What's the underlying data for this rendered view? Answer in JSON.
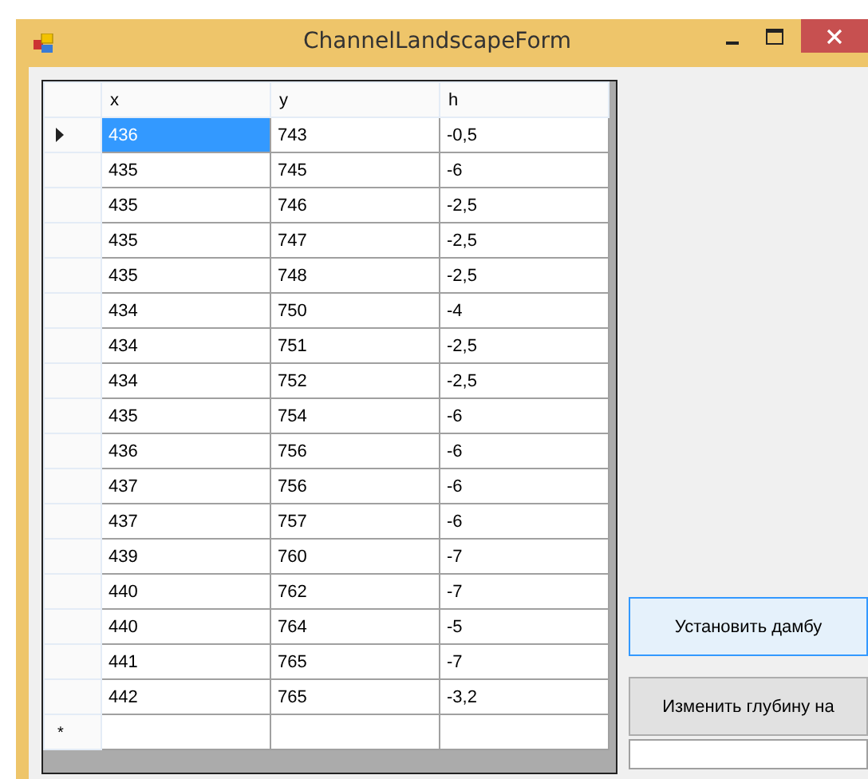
{
  "window": {
    "title": "ChannelLandscapeForm"
  },
  "grid": {
    "columns": [
      "x",
      "y",
      "h"
    ],
    "new_row_marker": "*",
    "rows": [
      {
        "current": true,
        "cells": [
          {
            "text": "436",
            "selected": true
          },
          {
            "text": "743",
            "selected": false
          },
          {
            "text": "-0,5",
            "selected": false
          }
        ]
      },
      {
        "current": false,
        "cells": [
          {
            "text": "435",
            "selected": false
          },
          {
            "text": "745",
            "selected": false
          },
          {
            "text": "-6",
            "selected": false
          }
        ]
      },
      {
        "current": false,
        "cells": [
          {
            "text": "435",
            "selected": false
          },
          {
            "text": "746",
            "selected": false
          },
          {
            "text": "-2,5",
            "selected": false
          }
        ]
      },
      {
        "current": false,
        "cells": [
          {
            "text": "435",
            "selected": false
          },
          {
            "text": "747",
            "selected": false
          },
          {
            "text": "-2,5",
            "selected": false
          }
        ]
      },
      {
        "current": false,
        "cells": [
          {
            "text": "435",
            "selected": false
          },
          {
            "text": "748",
            "selected": false
          },
          {
            "text": "-2,5",
            "selected": false
          }
        ]
      },
      {
        "current": false,
        "cells": [
          {
            "text": "434",
            "selected": false
          },
          {
            "text": "750",
            "selected": false
          },
          {
            "text": "-4",
            "selected": false
          }
        ]
      },
      {
        "current": false,
        "cells": [
          {
            "text": "434",
            "selected": false
          },
          {
            "text": "751",
            "selected": false
          },
          {
            "text": "-2,5",
            "selected": false
          }
        ]
      },
      {
        "current": false,
        "cells": [
          {
            "text": "434",
            "selected": false
          },
          {
            "text": "752",
            "selected": false
          },
          {
            "text": "-2,5",
            "selected": false
          }
        ]
      },
      {
        "current": false,
        "cells": [
          {
            "text": "435",
            "selected": false
          },
          {
            "text": "754",
            "selected": false
          },
          {
            "text": "-6",
            "selected": false
          }
        ]
      },
      {
        "current": false,
        "cells": [
          {
            "text": "436",
            "selected": false
          },
          {
            "text": "756",
            "selected": false
          },
          {
            "text": "-6",
            "selected": false
          }
        ]
      },
      {
        "current": false,
        "cells": [
          {
            "text": "437",
            "selected": false
          },
          {
            "text": "756",
            "selected": false
          },
          {
            "text": "-6",
            "selected": false
          }
        ]
      },
      {
        "current": false,
        "cells": [
          {
            "text": "437",
            "selected": false
          },
          {
            "text": "757",
            "selected": false
          },
          {
            "text": "-6",
            "selected": false
          }
        ]
      },
      {
        "current": false,
        "cells": [
          {
            "text": "439",
            "selected": false
          },
          {
            "text": "760",
            "selected": false
          },
          {
            "text": "-7",
            "selected": false
          }
        ]
      },
      {
        "current": false,
        "cells": [
          {
            "text": "440",
            "selected": false
          },
          {
            "text": "762",
            "selected": false
          },
          {
            "text": "-7",
            "selected": false
          }
        ]
      },
      {
        "current": false,
        "cells": [
          {
            "text": "440",
            "selected": false
          },
          {
            "text": "764",
            "selected": false
          },
          {
            "text": "-5",
            "selected": false
          }
        ]
      },
      {
        "current": false,
        "cells": [
          {
            "text": "441",
            "selected": false
          },
          {
            "text": "765",
            "selected": false
          },
          {
            "text": "-7",
            "selected": false
          }
        ]
      },
      {
        "current": false,
        "cells": [
          {
            "text": "442",
            "selected": false
          },
          {
            "text": "765",
            "selected": false
          },
          {
            "text": "-3,2",
            "selected": false
          }
        ]
      }
    ]
  },
  "buttons": [
    {
      "label": "Установить дамбу",
      "focused": true
    },
    {
      "label": "Изменить глубину на",
      "focused": false
    }
  ]
}
